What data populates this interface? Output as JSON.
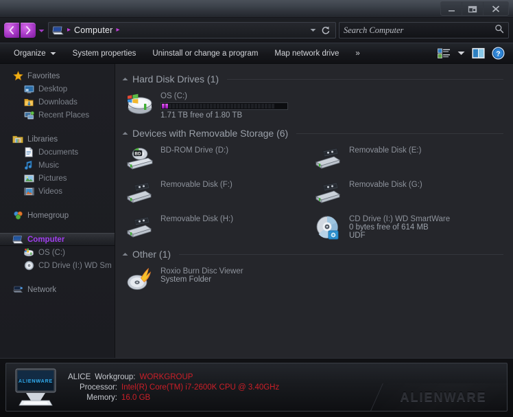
{
  "window": {
    "buttons": [
      {
        "name": "minimize",
        "glyph": "minimize-icon"
      },
      {
        "name": "restore",
        "glyph": "restore-icon"
      },
      {
        "name": "close",
        "glyph": "close-icon"
      }
    ]
  },
  "addressbar": {
    "back_icon": "back-arrow-icon",
    "forward_icon": "forward-arrow-icon",
    "history_icon": "chevron-down-icon",
    "computer_icon": "computer-icon",
    "crumb": "Computer",
    "separator": "▸",
    "dropdown_icon": "chevron-down-icon",
    "refresh_icon": "refresh-icon"
  },
  "search": {
    "placeholder": "Search Computer",
    "value": "",
    "icon": "search-icon"
  },
  "toolbar": {
    "items": [
      {
        "label": "Organize",
        "has_caret": true
      },
      {
        "label": "System properties",
        "has_caret": false
      },
      {
        "label": "Uninstall or change a program",
        "has_caret": false
      },
      {
        "label": "Map network drive",
        "has_caret": false
      },
      {
        "label": "»",
        "has_caret": false
      }
    ],
    "view_icon": "view-layout-icon",
    "view_caret": "chevron-down-icon",
    "preview_icon": "preview-pane-icon",
    "help_icon": "help-icon"
  },
  "sidebar": {
    "groups": [
      {
        "root": {
          "label": "Favorites",
          "icon": "star-icon"
        },
        "items": [
          {
            "label": "Desktop",
            "icon": "desktop-icon"
          },
          {
            "label": "Downloads",
            "icon": "downloads-folder-icon"
          },
          {
            "label": "Recent Places",
            "icon": "recent-places-icon"
          }
        ]
      },
      {
        "root": {
          "label": "Libraries",
          "icon": "libraries-icon"
        },
        "items": [
          {
            "label": "Documents",
            "icon": "documents-icon"
          },
          {
            "label": "Music",
            "icon": "music-icon"
          },
          {
            "label": "Pictures",
            "icon": "pictures-icon"
          },
          {
            "label": "Videos",
            "icon": "videos-icon"
          }
        ]
      },
      {
        "root": {
          "label": "Homegroup",
          "icon": "homegroup-icon"
        },
        "items": []
      },
      {
        "root": {
          "label": "Computer",
          "icon": "computer-icon",
          "selected": true
        },
        "items": [
          {
            "label": "OS (C:)",
            "icon": "hard-drive-icon"
          },
          {
            "label": "CD Drive (I:) WD Sm",
            "icon": "cd-drive-icon"
          }
        ]
      },
      {
        "root": {
          "label": "Network",
          "icon": "network-icon"
        },
        "items": []
      }
    ]
  },
  "content": {
    "groups": [
      {
        "title": "Hard Disk Drives (1)",
        "collapse_icon": "triangle-up-icon",
        "items": [
          {
            "name": "OS (C:)",
            "icon": "hard-drive-windows-icon",
            "capacity_bar": {
              "total_segments": 33,
              "filled_segments": 2,
              "fill_color": "#e45af5"
            },
            "sub": "1.71 TB free of 1.80 TB"
          }
        ]
      },
      {
        "title": "Devices with Removable Storage (6)",
        "collapse_icon": "triangle-up-icon",
        "items": [
          {
            "name": "BD-ROM Drive (D:)",
            "icon": "bd-rom-drive-icon"
          },
          {
            "name": "Removable Disk (E:)",
            "icon": "removable-disk-icon"
          },
          {
            "name": "Removable Disk (F:)",
            "icon": "removable-disk-icon"
          },
          {
            "name": "Removable Disk (G:)",
            "icon": "removable-disk-icon"
          },
          {
            "name": "Removable Disk (H:)",
            "icon": "removable-disk-icon"
          },
          {
            "name": "CD Drive (I:) WD SmartWare",
            "icon": "cd-drive-disc-icon",
            "sub": "0 bytes free of 614 MB",
            "sub2": "UDF"
          }
        ]
      },
      {
        "title": "Other (1)",
        "collapse_icon": "triangle-up-icon",
        "items": [
          {
            "name": "Roxio Burn Disc Viewer",
            "icon": "roxio-burn-icon",
            "sub": "System Folder"
          }
        ]
      }
    ]
  },
  "details": {
    "icon": "alienware-monitor-icon",
    "computer_name": "ALICE",
    "rows": [
      {
        "key": "Workgroup:",
        "value": "WORKGROUP"
      },
      {
        "key": "Processor:",
        "value": "Intel(R) Core(TM) i7-2600K CPU @ 3.40GHz"
      },
      {
        "key": "Memory:",
        "value": "16.0 GB"
      }
    ],
    "brand": "ALIENWARE"
  },
  "colors": {
    "accent_purple": "#a13ef0",
    "accent_magenta": "#c23fd9",
    "value_red": "#cc1f28",
    "content_bg": "#25262b",
    "sidebar_bg": "#1e1f24"
  }
}
